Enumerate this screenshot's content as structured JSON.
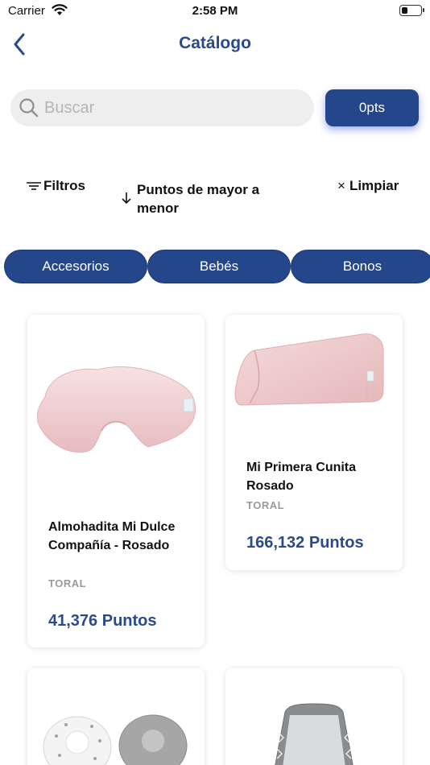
{
  "status_bar": {
    "carrier": "Carrier",
    "time": "2:58 PM",
    "battery_level": 0.35
  },
  "nav": {
    "title": "Catálogo",
    "back_icon": "chevron-left-icon"
  },
  "search": {
    "placeholder": "Buscar",
    "value": "",
    "icon": "search-icon"
  },
  "points_badge": "0pts",
  "filters": {
    "filter_label": "Filtros",
    "sort_label": "Puntos de mayor a menor",
    "clear_label": "Limpiar",
    "clear_icon_char": "×"
  },
  "categories": [
    "Accesorios",
    "Bebés",
    "Bonos"
  ],
  "products": [
    {
      "name": "Almohadita Mi Dulce Compañía - Rosado",
      "brand": "TORAL",
      "points": "41,376 Puntos",
      "image": "pink-pillow"
    },
    {
      "name": "Mi Primera Cunita Rosado",
      "brand": "TORAL",
      "points": "166,132 Puntos",
      "image": "pink-wedge"
    },
    {
      "name": "",
      "brand": "",
      "points": "",
      "image": "bibs"
    },
    {
      "name": "",
      "brand": "",
      "points": "",
      "image": "gray-cushion"
    }
  ],
  "colors": {
    "brand_blue": "#24468a",
    "title_blue": "#2a4a8c",
    "search_bg": "#eeeeef",
    "brand_gray": "#9a9a9a"
  }
}
